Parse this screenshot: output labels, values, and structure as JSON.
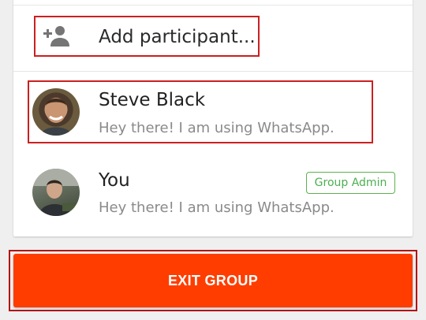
{
  "add_participant": {
    "icon": "person-add-icon",
    "label": "Add participant..."
  },
  "participants": [
    {
      "name": "Steve Black",
      "status": "Hey there! I am using WhatsApp."
    },
    {
      "name": "You",
      "status": "Hey there! I am using WhatsApp.",
      "badge": "Group Admin"
    }
  ],
  "exit_button": {
    "label": "EXIT GROUP"
  },
  "colors": {
    "accent": "#ff3d00",
    "highlight_border": "#cc1f1f",
    "admin_badge": "#4caf50"
  }
}
